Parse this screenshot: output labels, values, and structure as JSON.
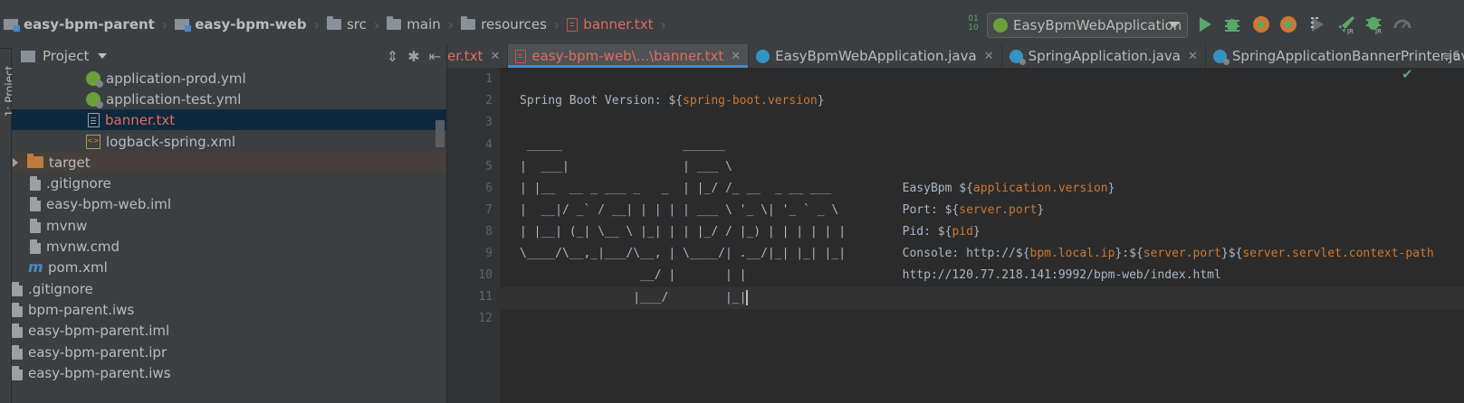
{
  "breadcrumbs": [
    {
      "label": "easy-bpm-parent",
      "bold": true
    },
    {
      "label": "easy-bpm-web",
      "bold": true
    },
    {
      "label": "src"
    },
    {
      "label": "main"
    },
    {
      "label": "resources"
    },
    {
      "label": "banner.txt",
      "red": true
    }
  ],
  "toolbar": {
    "run_config": "EasyBpmWebApplication",
    "sort_digits": "01\n10"
  },
  "side_tab": "1: Project",
  "project": {
    "title": "Project",
    "tree": [
      {
        "label": "application-prod.yml",
        "icon": "spring-config-icon",
        "indent": 82
      },
      {
        "label": "application-test.yml",
        "icon": "spring-config-icon",
        "indent": 82
      },
      {
        "label": "banner.txt",
        "icon": "text-file-icon",
        "indent": 82,
        "selected": true,
        "red": true
      },
      {
        "label": "logback-spring.xml",
        "icon": "xml-file-icon",
        "indent": 82
      },
      {
        "label": "target",
        "icon": "folder-icon",
        "indent": 18,
        "expander": true,
        "highlight": true
      },
      {
        "label": ".gitignore",
        "icon": "file-icon",
        "indent": 18
      },
      {
        "label": "easy-bpm-web.iml",
        "icon": "file-icon",
        "indent": 18
      },
      {
        "label": "mvnw",
        "icon": "file-icon",
        "indent": 18
      },
      {
        "label": "mvnw.cmd",
        "icon": "file-icon",
        "indent": 18
      },
      {
        "label": "pom.xml",
        "icon": "maven-icon",
        "indent": 18
      },
      {
        "label": ".gitignore",
        "icon": "file-icon",
        "indent": 0
      },
      {
        "label": "bpm-parent.iws",
        "icon": "file-icon",
        "indent": 0
      },
      {
        "label": "easy-bpm-parent.iml",
        "icon": "file-icon",
        "indent": 0
      },
      {
        "label": "easy-bpm-parent.ipr",
        "icon": "file-icon",
        "indent": 0
      },
      {
        "label": "easy-bpm-parent.iws",
        "icon": "file-icon",
        "indent": 0
      }
    ]
  },
  "tabs": [
    {
      "label": "er.txt",
      "red": true,
      "icon": "none"
    },
    {
      "label": "easy-bpm-web\\...\\banner.txt",
      "red": true,
      "active": true,
      "icon": "text-file-icon"
    },
    {
      "label": "EasyBpmWebApplication.java",
      "icon": "class-icon"
    },
    {
      "label": "SpringApplication.java",
      "icon": "class-locked-icon"
    },
    {
      "label": "SpringApplicationBannerPrinter.java",
      "icon": "class-locked-icon"
    }
  ],
  "tab_overflow": "≡6",
  "editor": {
    "lines": [
      {
        "n": "1",
        "text": ""
      },
      {
        "n": "2",
        "text": "Spring Boot Version: ${spring-boot.version}"
      },
      {
        "n": "3",
        "text": ""
      },
      {
        "n": "4",
        "text": " _____                 ______"
      },
      {
        "n": "5",
        "text": "|  ___|                | ___ \\"
      },
      {
        "n": "6",
        "text": "| |__  __ _ ___ _   _  | |_/ /_ __  _ __ ___          EasyBpm ${application.version}"
      },
      {
        "n": "7",
        "text": "|  __|/ _` / __| | | | | ___ \\ '_ \\| '_ ` _ \\         Port: ${server.port}"
      },
      {
        "n": "8",
        "text": "| |__| (_| \\__ \\ |_| | | |_/ / |_) | | | | | |        Pid: ${pid}"
      },
      {
        "n": "9",
        "text": "\\____/\\__,_|___/\\__, | \\____/| .__/|_| |_| |_|        Console: http://${bpm.local.ip}:${server.port}${server.servlet.context-path"
      },
      {
        "n": "10",
        "text": "                 __/ |       | |                      http://120.77.218.141:9992/bpm-web/index.html"
      },
      {
        "n": "11",
        "text": "                |___/        |_|"
      },
      {
        "n": "12",
        "text": ""
      }
    ]
  }
}
